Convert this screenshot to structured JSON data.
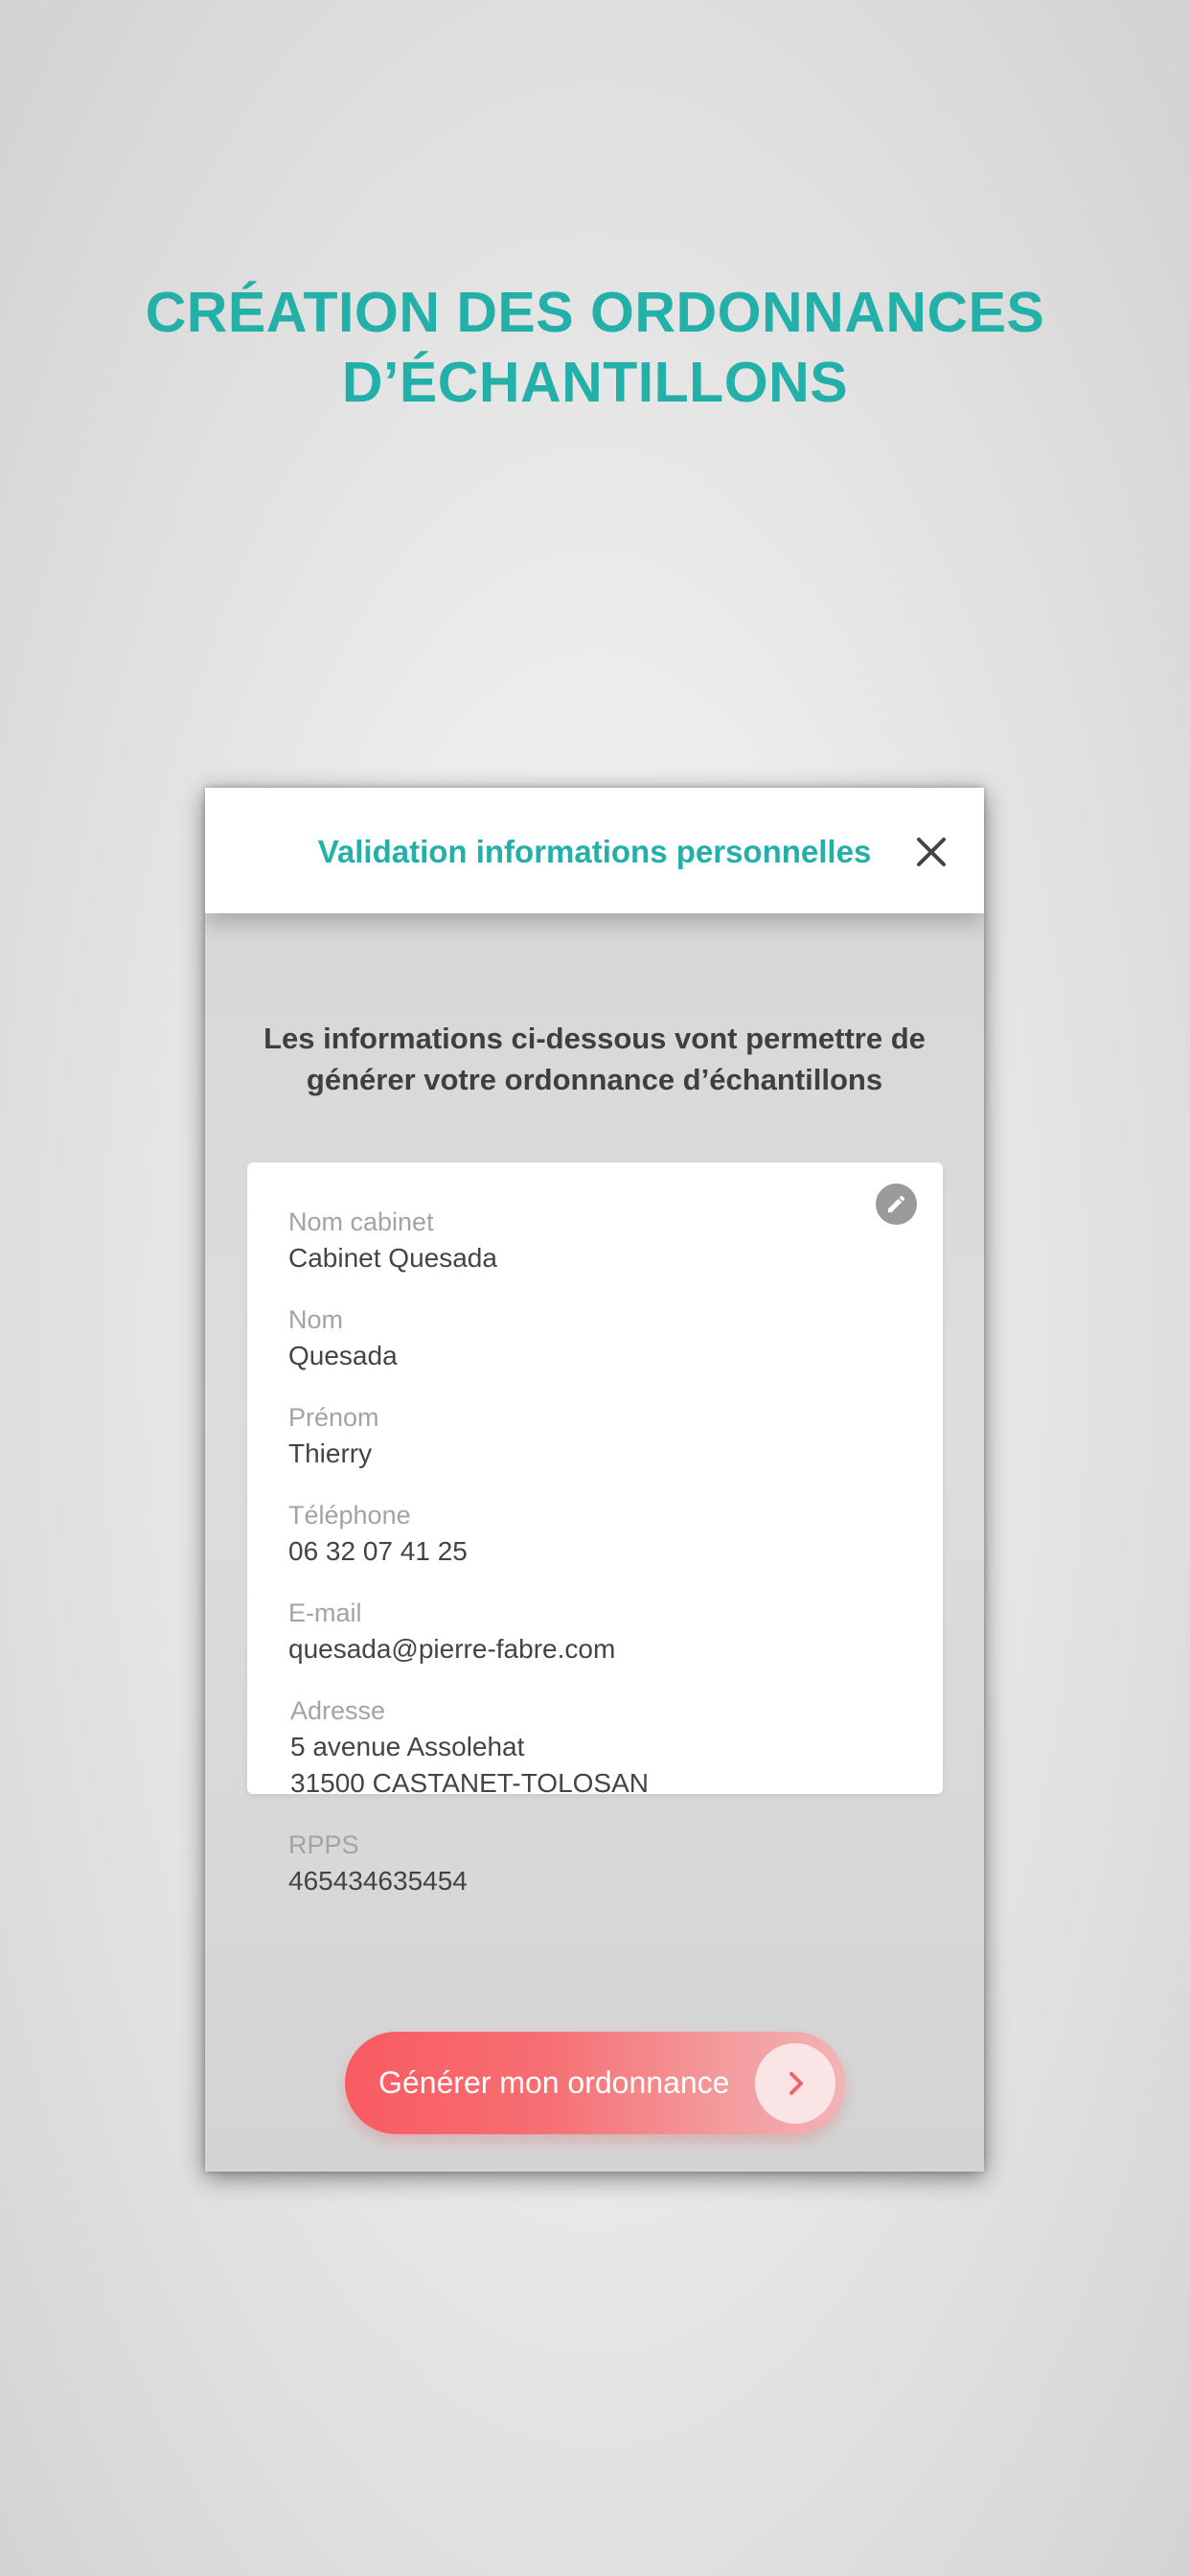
{
  "headline": {
    "line1": "CRÉATION DES ORDONNANCES",
    "line2": "D’ÉCHANTILLONS"
  },
  "modal": {
    "title": "Validation informations personnelles",
    "close_icon": "close-icon"
  },
  "intro": {
    "line1": "Les informations ci-dessous vont permettre de",
    "line2": "générer votre ordonnance d’échantillons"
  },
  "card": {
    "edit_icon": "pencil-icon",
    "fields": [
      {
        "label": "Nom cabinet",
        "value": "Cabinet Quesada"
      },
      {
        "label": "Nom",
        "value": "Quesada"
      },
      {
        "label": "Prénom",
        "value": "Thierry"
      },
      {
        "label": "Téléphone",
        "value": "06 32 07 41 25"
      },
      {
        "label": "E-mail",
        "value": "quesada@pierre-fabre.com"
      },
      {
        "label": "Adresse",
        "value": "5 avenue Assolehat",
        "value2": "31500 CASTANET-TOLOSAN"
      },
      {
        "label": "RPPS",
        "value": "465434635454"
      }
    ]
  },
  "cta": {
    "label": "Générer mon ordonnance",
    "icon": "chevron-right-icon"
  },
  "colors": {
    "accent_teal": "#22b0a8",
    "cta_red": "#f95b61",
    "label_grey": "#a3a3a3",
    "value_dark": "#444444"
  }
}
